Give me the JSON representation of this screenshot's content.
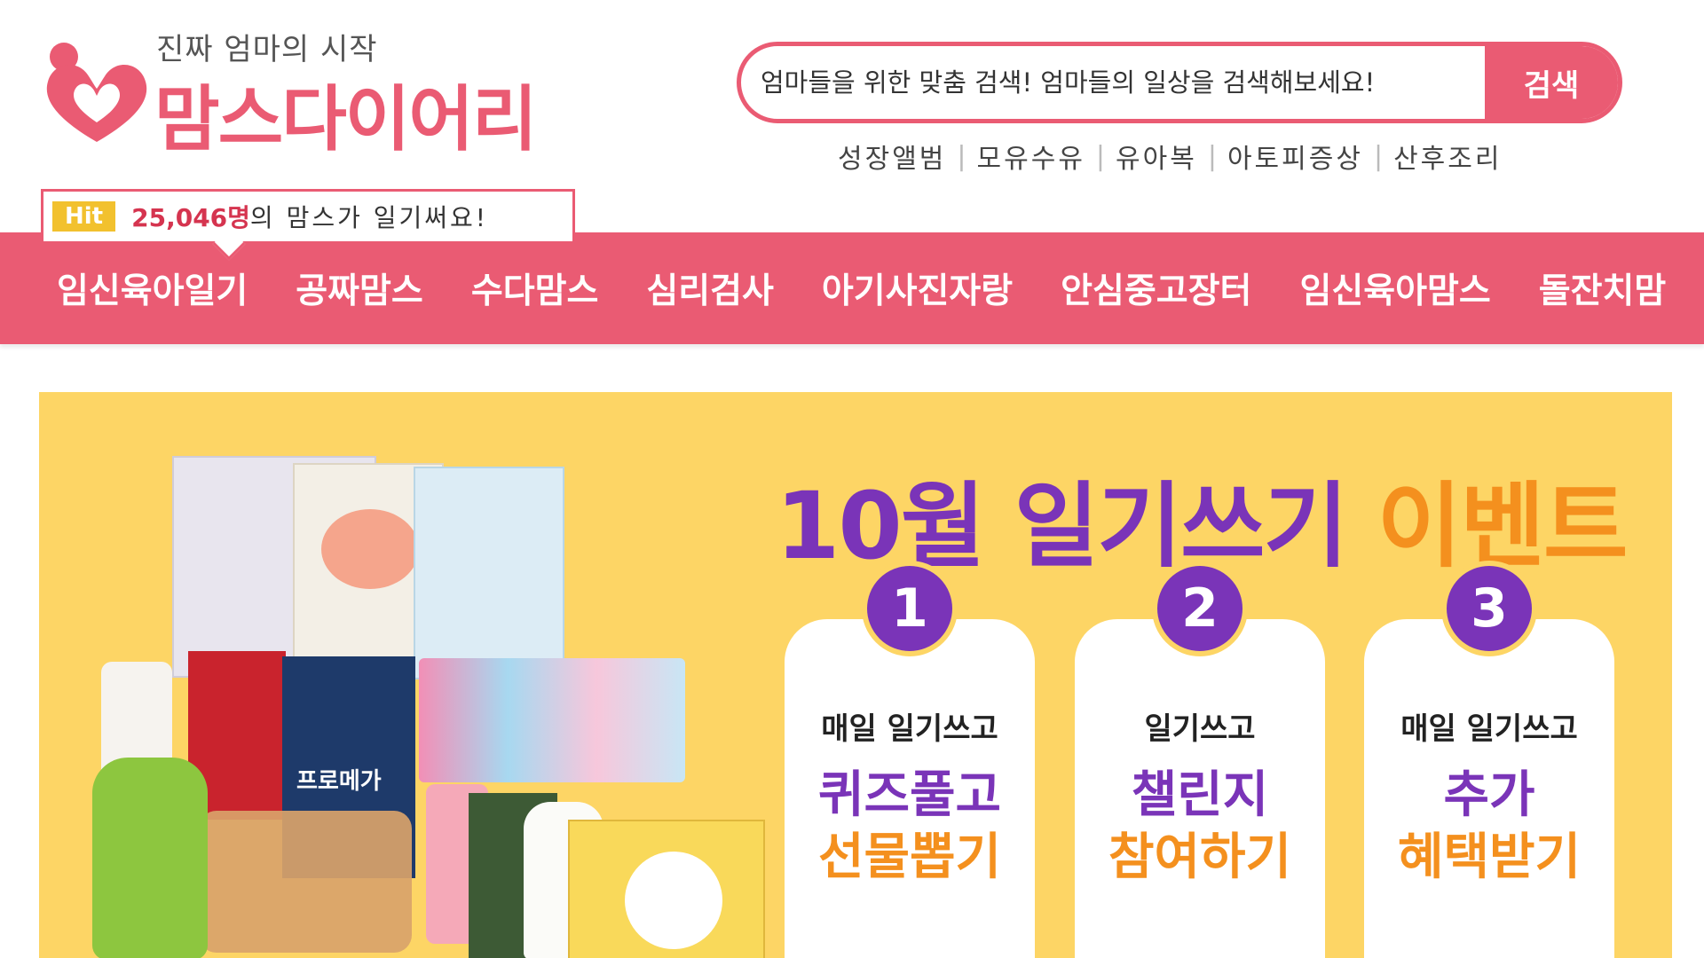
{
  "site": {
    "tagline": "진짜 엄마의 시작",
    "logo_text": "맘스다이어리"
  },
  "search": {
    "placeholder": "엄마들을 위한 맞춤 검색! 엄마들의 일상을 검색해보세요!",
    "button_label": "검색"
  },
  "keywords": [
    "성장앨범",
    "모유수유",
    "유아복",
    "아토피증상",
    "산후조리"
  ],
  "hit": {
    "badge": "Hit",
    "count": "25,046명",
    "text": "의 맘스가 일기써요!"
  },
  "nav": {
    "items": [
      "임신육아일기",
      "공짜맘스",
      "수다맘스",
      "심리검사",
      "아기사진자랑",
      "안심중고장터",
      "임신육아맘스",
      "돌잔치맘"
    ]
  },
  "banner": {
    "title_main": "10월 일기쓰기 ",
    "title_accent": "이벤트",
    "product_label": "프로메가",
    "steps": [
      {
        "num": "1",
        "sub": "매일 일기쓰고",
        "line1": "퀴즈풀고",
        "line2": "선물뽑기"
      },
      {
        "num": "2",
        "sub": "일기쓰고",
        "line1": "챌린지",
        "line2": "참여하기"
      },
      {
        "num": "3",
        "sub": "매일 일기쓰고",
        "line1": "추가",
        "line2": "혜택받기"
      }
    ]
  },
  "colors": {
    "brand_pink": "#ea5b73",
    "banner_yellow": "#fdd565",
    "purple": "#7a34b8",
    "orange": "#f4901e",
    "hit_yellow": "#f2c12e"
  }
}
